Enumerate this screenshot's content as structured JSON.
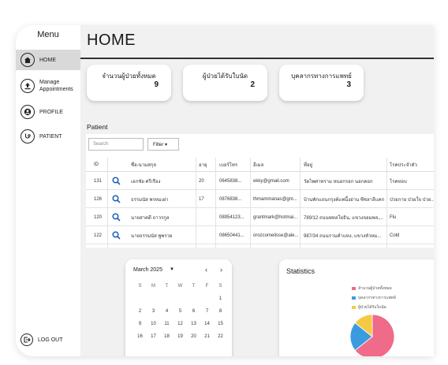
{
  "sidebar": {
    "menu_title": "Menu",
    "items": [
      {
        "label": "HOME",
        "icon": "home-icon"
      },
      {
        "label": "Manage Appointments",
        "icon": "upload-icon"
      },
      {
        "label": "PROFILE",
        "icon": "user-icon"
      },
      {
        "label": "PATIENT",
        "icon": "stethoscope-icon"
      }
    ],
    "logout": "LOG OUT"
  },
  "header": {
    "title": "HOME"
  },
  "cards": [
    {
      "label": "จำนวนผู้ป่วยทั้งหมด",
      "value": "9"
    },
    {
      "label": "ผู้ป่วยได้รับใบนัด",
      "value": "2"
    },
    {
      "label": "บุคลากรทางการแพทย์",
      "value": "3"
    }
  ],
  "patient": {
    "heading": "Patient",
    "search_placeholder": "Search",
    "filter_label": "Filter ▾",
    "columns": [
      "ID",
      "ชื่อ-นามสกุล",
      "อายุ",
      "เบอร์โทร",
      "อีเมล",
      "ที่อยู่",
      "โรคประจำตัว"
    ],
    "rows": [
      [
        "131",
        "เอกชัย ศรีเรือง",
        "20",
        "0645838...",
        "ekky@gmail.com",
        "วัดไพศาทราม หนอกรอก นอกคอก",
        "โรคหอบ"
      ],
      [
        "126",
        "ธรรมนัส พรหมเผ่า",
        "17",
        "0876838...",
        "thmammanas@gm...",
        "บ้านพักแถนกรุงค์แพนี้งอ่าน ซีซลาลีแคก",
        "ป่วยกาย ป่วยใจ ป่วย..."
      ],
      [
        "120",
        "นายสาคดี ถาวรกูล",
        "",
        "08954123...",
        "grantmark@hotmai...",
        "789/12 ถนนพหลโยธิน, แขวงจอมพล,...",
        "Flu"
      ],
      [
        "122",
        "นายธรรมนัส พูพรวย",
        "",
        "08650441...",
        "orozcomelisse@ale...",
        "987/34 ถนนรามคำแหง, แขวงหัวหม...",
        "Cold"
      ]
    ]
  },
  "calendar": {
    "month": "March 2025",
    "dow": [
      "S",
      "M",
      "T",
      "W",
      "T",
      "F",
      "S"
    ],
    "weeks": [
      [
        "",
        "",
        "",
        "",
        "",
        "",
        "1"
      ],
      [
        "2",
        "3",
        "4",
        "5",
        "6",
        "7",
        "8"
      ],
      [
        "9",
        "10",
        "11",
        "12",
        "13",
        "14",
        "15"
      ],
      [
        "16",
        "17",
        "18",
        "19",
        "20",
        "21",
        "22"
      ]
    ]
  },
  "statistics": {
    "title": "Statistics",
    "legend": [
      {
        "label": "จำนวนผู้ป่วยทั้งหมด",
        "color": "#f06a8a"
      },
      {
        "label": "บุคลากรทางการแพทย์",
        "color": "#3b9be0"
      },
      {
        "label": "ผู้ป่วยได้รับใบนัด",
        "color": "#f5c945"
      }
    ],
    "values": [
      9,
      3,
      2
    ]
  }
}
